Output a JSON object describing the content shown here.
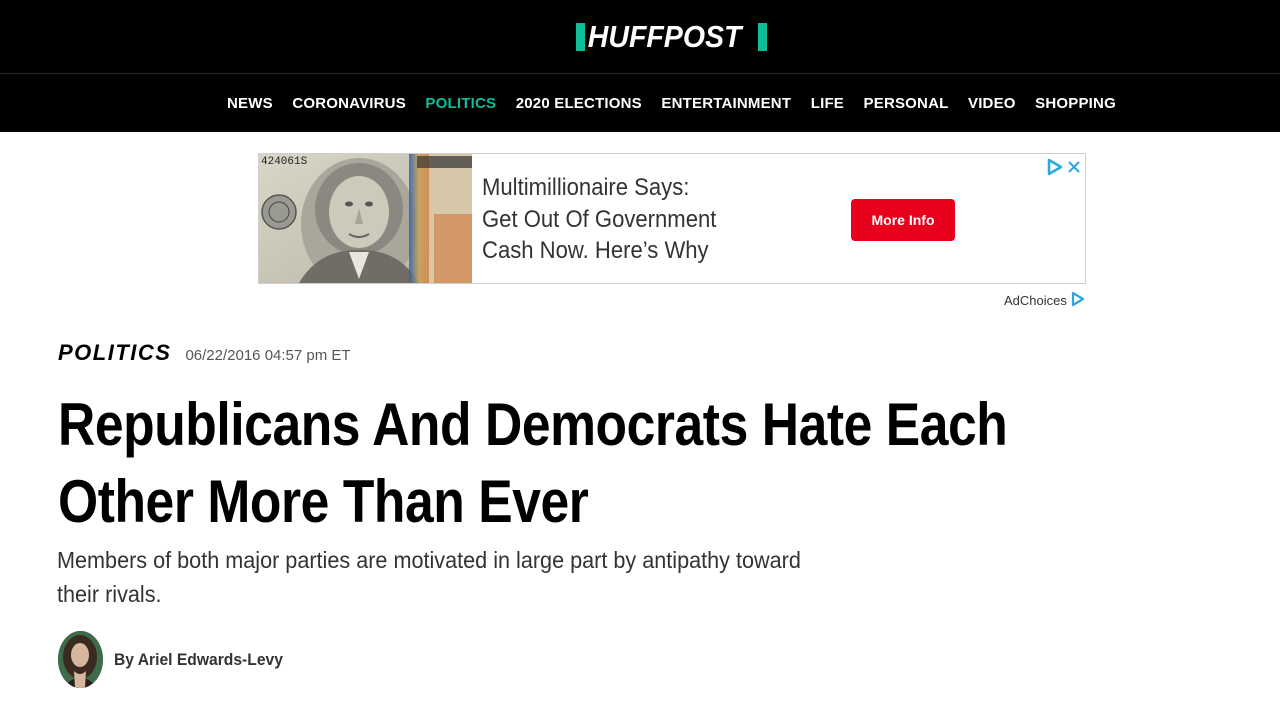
{
  "logo": {
    "text": "HUFFPOST"
  },
  "nav": {
    "items": [
      {
        "label": "NEWS"
      },
      {
        "label": "CORONAVIRUS"
      },
      {
        "label": "POLITICS"
      },
      {
        "label": "2020 ELECTIONS"
      },
      {
        "label": "ENTERTAINMENT"
      },
      {
        "label": "LIFE"
      },
      {
        "label": "PERSONAL"
      },
      {
        "label": "VIDEO"
      },
      {
        "label": "SHOPPING"
      }
    ],
    "active": "POLITICS"
  },
  "ad": {
    "line1": "Multimillionaire Says:",
    "line2": "Get Out Of Government",
    "line3": "Cash Now. Here’s Why",
    "button": "More Info",
    "image_serial": "424061S",
    "choices": "AdChoices"
  },
  "article": {
    "section": "POLITICS",
    "timestamp": "06/22/2016 04:57 pm ET",
    "headline": "Republicans And Democrats Hate Each Other More Than Ever",
    "dek": "Members of both major parties are motivated in large part by antipathy toward their rivals.",
    "byline": "By Ariel Edwards-Levy"
  },
  "colors": {
    "brand_green": "#0dbe98",
    "nav_bg": "#000000",
    "ad_button": "#e8001c",
    "adchoices_blue": "#29a8e0"
  },
  "icons": [
    "adchoices-icon",
    "close-icon"
  ]
}
